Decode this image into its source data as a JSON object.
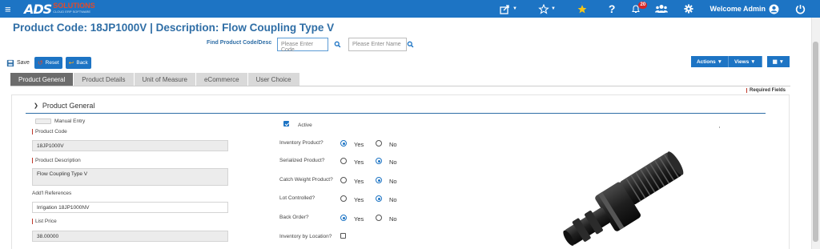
{
  "app": {
    "logo_main": "ADS",
    "logo_solutions": "SOLUTIONS",
    "logo_tagline": "CLOUD ERP SOFTWARE",
    "welcome": "Welcome Admin",
    "notification_count": "20",
    "brand_color": "#1d74c4"
  },
  "page": {
    "title": "Product Code:  18JP1000V | Description: Flow Coupling Type V"
  },
  "find": {
    "label": "Find Product Code/Desc",
    "code_placeholder": "Please Enter Code",
    "name_placeholder": "Please Enter Name"
  },
  "toolbar": {
    "save": "Save",
    "reset": "Reset",
    "back": "Back",
    "actions": "Actions",
    "views": "Views"
  },
  "tabs": [
    {
      "label": "Product General",
      "active": true
    },
    {
      "label": "Product Details",
      "active": false
    },
    {
      "label": "Unit of Measure",
      "active": false
    },
    {
      "label": "eCommerce",
      "active": false
    },
    {
      "label": "User Choice",
      "active": false
    }
  ],
  "required_fields": "Required Fields",
  "section": {
    "title": "Product General"
  },
  "form": {
    "manual_entry": "Manual Entry",
    "product_code_label": "Product Code",
    "product_code_value": "18JP1000V",
    "product_desc_label": "Product Description",
    "product_desc_value": "Flow Coupling Type V",
    "add_refs_label": "Add'l References",
    "add_refs_value": "Irrigation 18JP1000NV",
    "list_price_label": "List Price",
    "list_price_value": "38.00000",
    "active_label": "Active",
    "yes": "Yes",
    "no": "No",
    "questions": [
      {
        "label": "Inventory Product?",
        "value": "Yes"
      },
      {
        "label": "Serialized Product?",
        "value": "No"
      },
      {
        "label": "Catch Weight Product?",
        "value": "No"
      },
      {
        "label": "Lot Controlled?",
        "value": "No"
      },
      {
        "label": "Back Order?",
        "value": "Yes"
      }
    ],
    "inventory_by_location": "Inventory by Location?"
  }
}
